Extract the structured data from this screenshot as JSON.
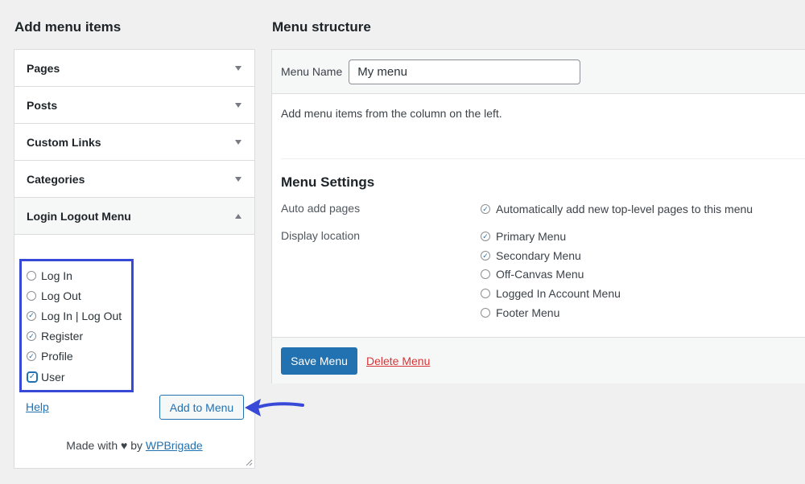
{
  "left": {
    "title": "Add menu items",
    "sections": [
      {
        "label": "Pages",
        "state": "collapsed"
      },
      {
        "label": "Posts",
        "state": "collapsed"
      },
      {
        "label": "Custom Links",
        "state": "collapsed"
      },
      {
        "label": "Categories",
        "state": "collapsed"
      },
      {
        "label": "Login Logout Menu",
        "state": "expanded"
      }
    ],
    "items": [
      {
        "label": "Log In",
        "checked": false
      },
      {
        "label": "Log Out",
        "checked": false
      },
      {
        "label": "Log In | Log Out",
        "checked": true
      },
      {
        "label": "Register",
        "checked": true
      },
      {
        "label": "Profile",
        "checked": true
      },
      {
        "label": "User",
        "checked": true
      }
    ],
    "help_link": "Help",
    "add_button": "Add to Menu",
    "made_with_prefix": "Made with",
    "made_with_by": "by",
    "made_with_link": "WPBrigade"
  },
  "right": {
    "title": "Menu structure",
    "menu_name_label": "Menu Name",
    "menu_name_value": "My menu",
    "hint": "Add menu items from the column on the left.",
    "settings_title": "Menu Settings",
    "auto_add_label": "Auto add pages",
    "auto_add_option": {
      "label": "Automatically add new top-level pages to this menu",
      "checked": true
    },
    "display_location_label": "Display location",
    "locations": [
      {
        "label": "Primary Menu",
        "checked": true
      },
      {
        "label": "Secondary Menu",
        "checked": true
      },
      {
        "label": "Off-Canvas Menu",
        "checked": false
      },
      {
        "label": "Logged In Account Menu",
        "checked": false
      },
      {
        "label": "Footer Menu",
        "checked": false
      }
    ],
    "save_button": "Save Menu",
    "delete_link": "Delete Menu"
  },
  "annotation": {
    "highlight_color": "#3849d8",
    "arrow_color": "#3849d8"
  }
}
